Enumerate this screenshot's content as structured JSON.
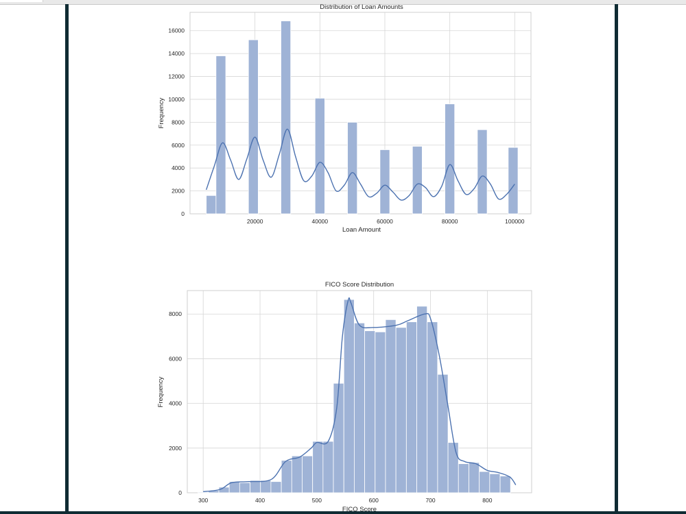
{
  "chart_data": [
    {
      "type": "bar",
      "title": "Distribution of Loan Amounts",
      "xlabel": "Loan Amount",
      "ylabel": "Frequency",
      "xlim": [
        0,
        105000
      ],
      "ylim": [
        0,
        17600
      ],
      "xticks": [
        20000,
        40000,
        60000,
        80000,
        100000
      ],
      "yticks": [
        0,
        2000,
        4000,
        6000,
        8000,
        10000,
        12000,
        14000,
        16000
      ],
      "grid": true,
      "bin_width": 3000,
      "bins": [
        {
          "x": 6500,
          "value": 1600
        },
        {
          "x": 9500,
          "value": 13800
        },
        {
          "x": 19500,
          "value": 15200
        },
        {
          "x": 29500,
          "value": 16850
        },
        {
          "x": 40000,
          "value": 10100
        },
        {
          "x": 50000,
          "value": 8000
        },
        {
          "x": 60000,
          "value": 5600
        },
        {
          "x": 70000,
          "value": 5900
        },
        {
          "x": 80000,
          "value": 9600
        },
        {
          "x": 90000,
          "value": 7350
        },
        {
          "x": 99500,
          "value": 5800
        }
      ],
      "kde": {
        "x": [
          5000,
          7500,
          10000,
          12500,
          15000,
          17500,
          20000,
          22500,
          25000,
          27500,
          30000,
          32500,
          35000,
          37500,
          40000,
          42500,
          45000,
          47500,
          50000,
          52500,
          55000,
          57500,
          60000,
          62500,
          65000,
          67500,
          70000,
          72500,
          75000,
          77500,
          80000,
          82500,
          85000,
          87500,
          90000,
          92500,
          95000,
          97500,
          100000
        ],
        "y": [
          2100,
          4200,
          6200,
          4700,
          3000,
          4800,
          6700,
          4700,
          3200,
          5200,
          7400,
          5000,
          2900,
          3300,
          4500,
          3600,
          2000,
          2500,
          3600,
          2600,
          1500,
          1800,
          2500,
          1900,
          1200,
          1600,
          2600,
          2300,
          1500,
          2400,
          4300,
          2900,
          1700,
          2200,
          3300,
          2600,
          1300,
          1700,
          2600
        ]
      }
    },
    {
      "type": "bar",
      "title": "FICO Score Distribution",
      "xlabel": "FICO Score",
      "ylabel": "Frequency",
      "xlim": [
        272,
        878
      ],
      "ylim": [
        0,
        9050
      ],
      "xticks": [
        300,
        400,
        500,
        600,
        700,
        800
      ],
      "yticks": [
        0,
        2000,
        4000,
        6000,
        8000
      ],
      "grid": true,
      "bin_width": 18.3,
      "bins": [
        {
          "x": 300,
          "value": 30
        },
        {
          "x": 318.3,
          "value": 100
        },
        {
          "x": 336.7,
          "value": 250
        },
        {
          "x": 355,
          "value": 500
        },
        {
          "x": 373.3,
          "value": 450
        },
        {
          "x": 391.7,
          "value": 550
        },
        {
          "x": 410,
          "value": 550
        },
        {
          "x": 428.3,
          "value": 500
        },
        {
          "x": 446.7,
          "value": 1450
        },
        {
          "x": 465,
          "value": 1650
        },
        {
          "x": 483.3,
          "value": 1650
        },
        {
          "x": 501.7,
          "value": 2300
        },
        {
          "x": 520,
          "value": 2300
        },
        {
          "x": 538.3,
          "value": 4900
        },
        {
          "x": 556.7,
          "value": 8650
        },
        {
          "x": 575,
          "value": 7600
        },
        {
          "x": 593.3,
          "value": 7250
        },
        {
          "x": 611.7,
          "value": 7200
        },
        {
          "x": 630,
          "value": 7750
        },
        {
          "x": 648.3,
          "value": 7400
        },
        {
          "x": 666.7,
          "value": 7650
        },
        {
          "x": 685,
          "value": 8350
        },
        {
          "x": 703.3,
          "value": 7650
        },
        {
          "x": 721.7,
          "value": 5300
        },
        {
          "x": 740,
          "value": 2250
        },
        {
          "x": 758.3,
          "value": 1300
        },
        {
          "x": 776.7,
          "value": 1350
        },
        {
          "x": 795,
          "value": 950
        },
        {
          "x": 813.3,
          "value": 850
        },
        {
          "x": 831.7,
          "value": 750
        }
      ],
      "kde": {
        "x": [
          300,
          330,
          350,
          380,
          420,
          445,
          470,
          490,
          500,
          520,
          535,
          545,
          555,
          560,
          575,
          600,
          640,
          660,
          690,
          700,
          715,
          730,
          745,
          760,
          780,
          800,
          820,
          840,
          850
        ],
        "y": [
          50,
          150,
          450,
          500,
          600,
          1400,
          1600,
          2000,
          2250,
          2300,
          3800,
          7000,
          8600,
          8500,
          7500,
          7400,
          7500,
          7700,
          8000,
          7800,
          6200,
          4000,
          1800,
          1400,
          1300,
          1000,
          900,
          700,
          350
        ]
      }
    }
  ]
}
